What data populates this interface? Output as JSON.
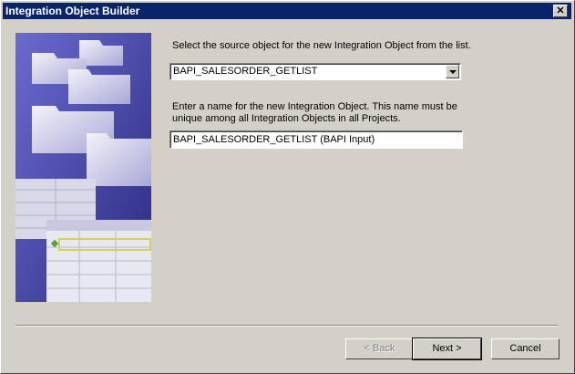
{
  "window": {
    "title": "Integration Object Builder"
  },
  "form": {
    "source_prompt": "Select the source object for the new Integration Object from the list.",
    "source_value": "BAPI_SALESORDER_GETLIST",
    "name_prompt": "Enter a name for the new Integration Object. This name must be unique among all Integration Objects in all Projects.",
    "name_value": "BAPI_SALESORDER_GETLIST (BAPI Input)"
  },
  "buttons": {
    "back": "< Back",
    "next": "Next >",
    "cancel": "Cancel"
  },
  "icons": {
    "close": "close-icon",
    "dropdown": "chevron-down-icon"
  },
  "colors": {
    "titlebar": "#0a246a",
    "face": "#d4d0c8",
    "art_background": "#3a3a9c"
  }
}
